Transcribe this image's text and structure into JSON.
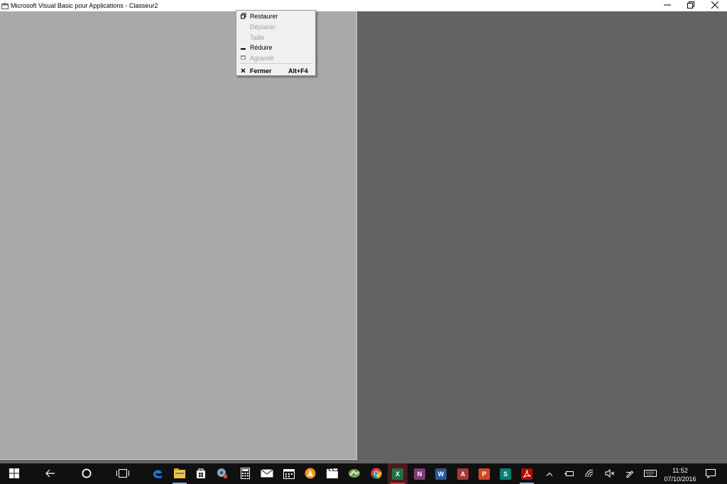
{
  "window": {
    "title": "Microsoft Visual Basic pour Applications - Classeur2"
  },
  "system_menu": {
    "items": [
      {
        "label": "Restaurer",
        "icon": "restore-icon",
        "enabled": true
      },
      {
        "label": "Déplacer",
        "icon": "",
        "enabled": false
      },
      {
        "label": "Taille",
        "icon": "",
        "enabled": false
      },
      {
        "label": "Réduire",
        "icon": "minimize-icon",
        "enabled": true
      },
      {
        "label": "Agrandir",
        "icon": "maximize-icon",
        "enabled": false
      }
    ],
    "close": {
      "label": "Fermer",
      "shortcut": "Alt+F4",
      "icon": "close-icon"
    }
  },
  "taskbar": {
    "pinned": [
      "start-icon",
      "back-icon",
      "cortana-icon",
      "task-view-icon",
      "edge-icon",
      "file-explorer-icon",
      "store-icon",
      "media-player-icon",
      "calculator-icon",
      "mail-icon",
      "calendar-icon",
      "vlc-icon",
      "movies-icon",
      "photos-icon",
      "chrome-icon",
      "excel-icon",
      "onenote-icon",
      "word-icon",
      "access-icon",
      "powerpoint-icon",
      "sway-icon",
      "acrobat-icon"
    ],
    "app_letters": {
      "excel": "X",
      "onenote": "N",
      "word": "W",
      "access": "A",
      "powerpoint": "P",
      "sway": "S"
    },
    "tray": [
      "chevron-up-icon",
      "battery-icon",
      "wifi-icon",
      "volume-muted-icon",
      "pen-icon",
      "keyboard-icon"
    ],
    "time": "11:52",
    "date": "07/10/2016"
  },
  "colors": {
    "mdi_workspace": "#636363",
    "child_window": "#a9a9a9",
    "taskbar": "#101010",
    "menu_background": "#f0f0f0"
  }
}
